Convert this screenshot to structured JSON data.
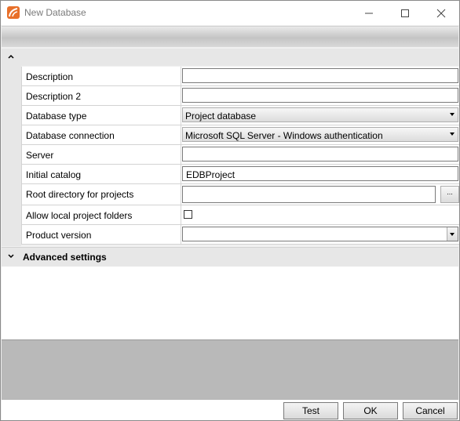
{
  "window": {
    "title": "New Database",
    "controls": {
      "minimize": "minimize-icon",
      "maximize": "maximize-icon",
      "close": "close-icon"
    }
  },
  "properties": {
    "rows": [
      {
        "label": "Description",
        "value": ""
      },
      {
        "label": "Description 2",
        "value": ""
      },
      {
        "label": "Database type",
        "value": "Project database"
      },
      {
        "label": "Database connection",
        "value": "Microsoft SQL Server - Windows authentication"
      },
      {
        "label": "Server",
        "value": ""
      },
      {
        "label": "Initial catalog",
        "value": "EDBProject"
      },
      {
        "label": "Root directory for projects",
        "value": "",
        "browse_label": "..."
      },
      {
        "label": "Allow local project folders",
        "checked": false
      },
      {
        "label": "Product version",
        "value": ""
      }
    ]
  },
  "advanced": {
    "label": "Advanced settings"
  },
  "buttons": {
    "test": "Test",
    "ok": "OK",
    "cancel": "Cancel"
  }
}
